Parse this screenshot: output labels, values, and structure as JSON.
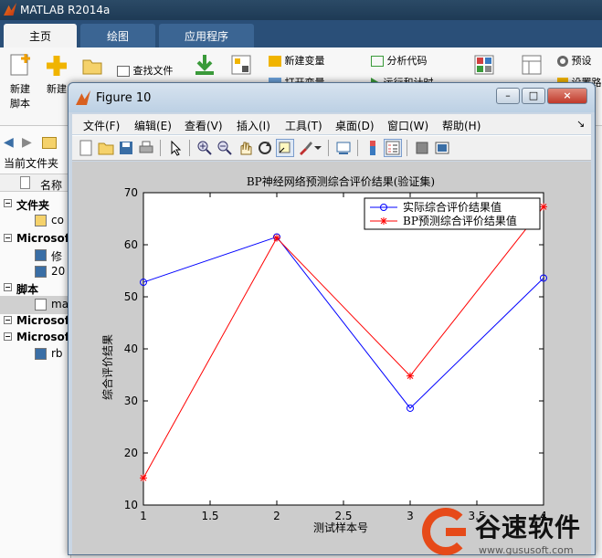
{
  "app": {
    "title": "MATLAB R2014a"
  },
  "ribbon_tabs": [
    "主页",
    "绘图",
    "应用程序"
  ],
  "ribbon": {
    "new_script": "新建\n脚本",
    "new_label": "新建",
    "find_files": "查找文件",
    "new_variable": "新建变量",
    "open_variable": "打开变量",
    "analyze_code": "分析代码",
    "run_and_time": "运行和计时",
    "preferences": "预设",
    "set_path": "设置路"
  },
  "left_panel": {
    "current_folder": "当前文件夹",
    "name_col": "名称",
    "rows": [
      {
        "label": "文件夹",
        "kind": "head"
      },
      {
        "label": "co",
        "kind": "folder"
      },
      {
        "label": "Microsof",
        "kind": "head"
      },
      {
        "label": "修",
        "kind": "doc"
      },
      {
        "label": "20",
        "kind": "doc"
      },
      {
        "label": "脚本",
        "kind": "head"
      },
      {
        "label": "ma",
        "kind": "script"
      },
      {
        "label": "Microsof",
        "kind": "head"
      },
      {
        "label": "Microsof",
        "kind": "head"
      },
      {
        "label": "rb",
        "kind": "doc"
      }
    ]
  },
  "figure": {
    "title": "Figure 10",
    "menu": [
      "文件(F)",
      "编辑(E)",
      "查看(V)",
      "插入(I)",
      "工具(T)",
      "桌面(D)",
      "窗口(W)",
      "帮助(H)"
    ],
    "toolbar_icons": [
      "new-icon",
      "open-icon",
      "save-icon",
      "print-icon",
      "pointer-icon",
      "zoom-in-icon",
      "zoom-out-icon",
      "pan-icon",
      "rotate-icon",
      "data-cursor-icon",
      "brush-icon",
      "brush-dropdown-icon",
      "link-icon",
      "colorbar-icon",
      "legend-icon",
      "hide-plottools-icon",
      "show-plottools-icon"
    ]
  },
  "chart_data": {
    "type": "line",
    "title": "BP神经网络预测综合评价结果(验证集)",
    "xlabel": "测试样本号",
    "ylabel": "综合评价结果",
    "xlim": [
      1,
      4
    ],
    "ylim": [
      10,
      70
    ],
    "xticks": [
      "1",
      "1.5",
      "2",
      "2.5",
      "3",
      "3.5",
      "4"
    ],
    "yticks": [
      "10",
      "20",
      "30",
      "40",
      "50",
      "60",
      "70"
    ],
    "legend_position": "top-right",
    "x": [
      1,
      2,
      3,
      4
    ],
    "series": [
      {
        "name": "实际综合评价结果值",
        "values": [
          52.8,
          61.5,
          28.6,
          53.6
        ],
        "color": "#0000ff",
        "marker": "circle"
      },
      {
        "name": "BP预测综合评价结果值",
        "values": [
          15.2,
          61.3,
          34.8,
          67.3
        ],
        "color": "#ff0000",
        "marker": "star"
      }
    ]
  },
  "watermark": {
    "text": "谷速软件",
    "url": "www.gususoft.com"
  }
}
